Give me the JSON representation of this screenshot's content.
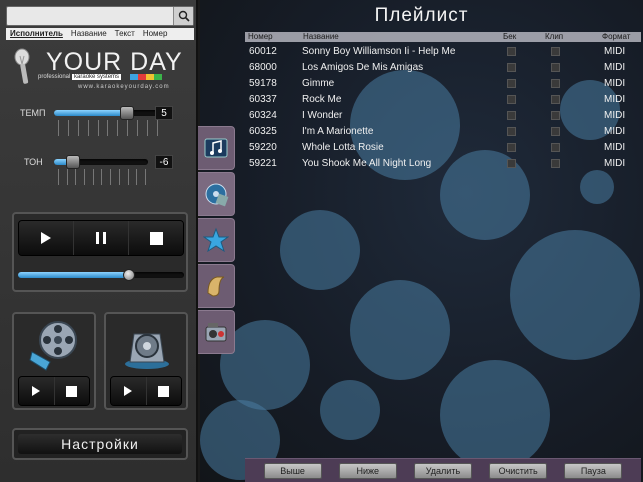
{
  "search": {
    "placeholder": "",
    "value": ""
  },
  "filters": [
    "Исполнитель",
    "Название",
    "Текст",
    "Номер"
  ],
  "logo": {
    "title": "YOUR DAY",
    "sub_prefix": "professional",
    "sub_highlight": "karaoke systems",
    "url": "www.karaokeyourday.com"
  },
  "tempo": {
    "label": "ТЕМП",
    "value": "5",
    "level_pct": 70
  },
  "tone": {
    "label": "ТОН",
    "value": "-6",
    "level_pct": 20
  },
  "progress_pct": 67,
  "settings_label": "Настройки",
  "main": {
    "title": "Плейлист"
  },
  "columns": {
    "number": "Номер",
    "title": "Название",
    "backing": "Бек",
    "clip": "Клип",
    "format": "Формат"
  },
  "rows": [
    {
      "number": "60012",
      "title": "Sonny Boy Williamson Ii - Help Me",
      "format": "MIDI"
    },
    {
      "number": "68000",
      "title": "Los Amigos De Mis Amigas",
      "format": "MIDI"
    },
    {
      "number": "59178",
      "title": "Gimme",
      "format": "MIDI"
    },
    {
      "number": "60337",
      "title": "Rock Me",
      "format": "MIDI"
    },
    {
      "number": "60324",
      "title": "I Wonder",
      "format": "MIDI"
    },
    {
      "number": "60325",
      "title": "I'm A Marionette",
      "format": "MIDI"
    },
    {
      "number": "59220",
      "title": "Whole Lotta Rosie",
      "format": "MIDI"
    },
    {
      "number": "59221",
      "title": "You Shook Me All Night Long",
      "format": "MIDI"
    }
  ],
  "bottom": {
    "up": "Выше",
    "down": "Ниже",
    "delete": "Удалить",
    "clear": "Очистить",
    "pause": "Пауза"
  },
  "colors": {
    "accent": "#2b89c9",
    "tab": "#6d5c72",
    "bottom_bar": "#4d3c55"
  }
}
